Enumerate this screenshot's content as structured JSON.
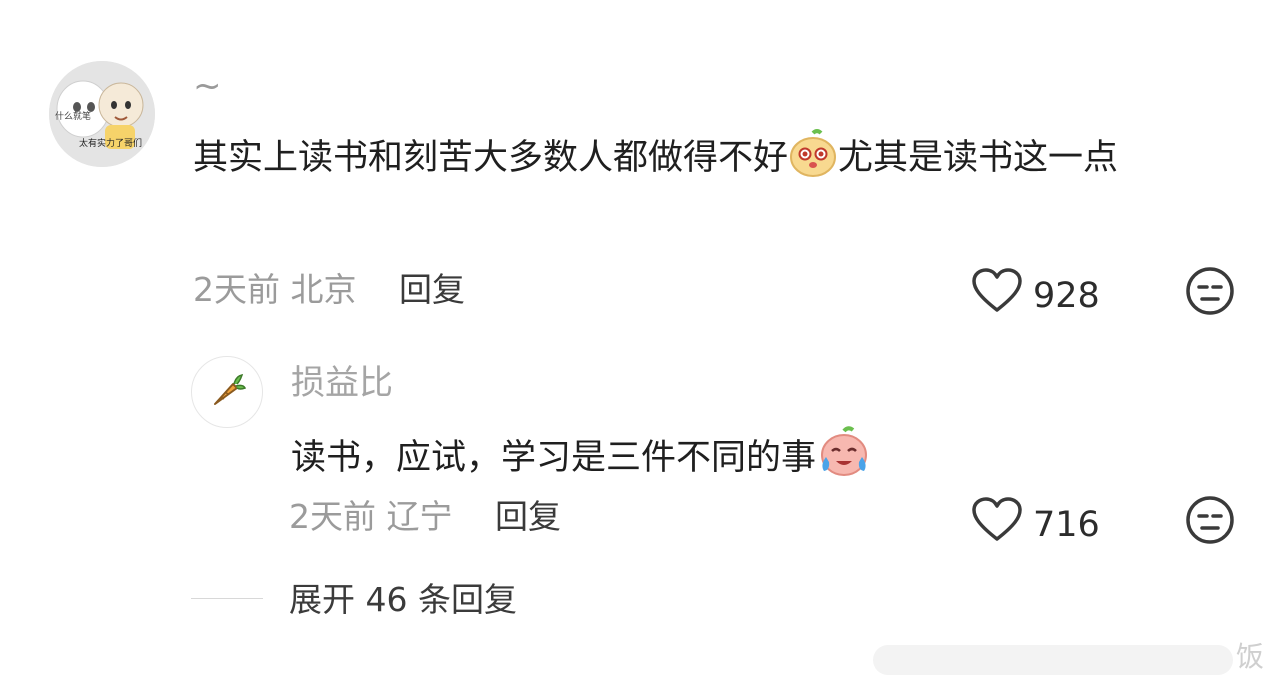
{
  "comment": {
    "username": "~",
    "avatar_text_top": "什么就笔",
    "avatar_text_bottom": "太有实力了哥们",
    "text_part1": "其实上读书和刻苦大多数人都做得不好",
    "text_part2": "尤其是读书这一点",
    "time": "2天前",
    "location": "北京",
    "reply_label": "回复",
    "likes": "928",
    "inline_emoji": "pear-face-emoji"
  },
  "reply": {
    "username": "损益比",
    "text": "读书，应试，学习是三件不同的事",
    "time": "2天前",
    "location": "辽宁",
    "reply_label": "回复",
    "likes": "716",
    "inline_emoji": "crying-peach-emoji"
  },
  "expand": {
    "label": "展开 46 条回复"
  },
  "watermark": {
    "text": "饭"
  },
  "colors": {
    "meta": "#9b9b9b",
    "text": "#1f1f1f",
    "background": "#ffffff"
  }
}
